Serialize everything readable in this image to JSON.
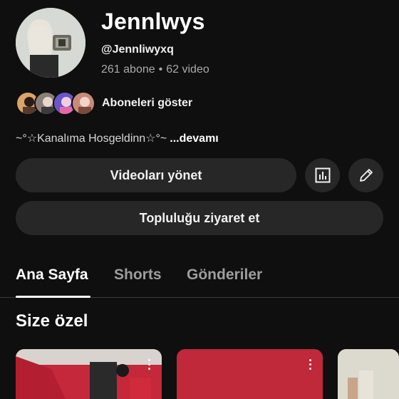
{
  "channel": {
    "name": "Jennlwys",
    "handle": "@Jennliwyxq",
    "subscribers": "261 abone",
    "separator": "•",
    "videos": "62 video",
    "description": "~°☆Kanalıma Hosgeldinn☆°~",
    "more_label": "...devamı"
  },
  "subscribers_row": {
    "show_label": "Aboneleri göster",
    "avatars": [
      "subscriber-avatar-1",
      "subscriber-avatar-2",
      "subscriber-avatar-3",
      "subscriber-avatar-4"
    ]
  },
  "actions": {
    "manage_videos_label": "Videoları yönet",
    "stats_icon": "analytics-icon",
    "edit_icon": "pencil-icon",
    "visit_community_label": "Topluluğu ziyaret et"
  },
  "tabs": [
    {
      "label": "Ana Sayfa",
      "active": true
    },
    {
      "label": "Shorts",
      "active": false
    },
    {
      "label": "Gönderiler",
      "active": false
    }
  ],
  "section": {
    "title": "Size özel"
  },
  "colors": {
    "background": "#0f0f0f",
    "button": "#272727",
    "text_primary": "#f1f1f1",
    "text_secondary": "#aaaaaa"
  }
}
